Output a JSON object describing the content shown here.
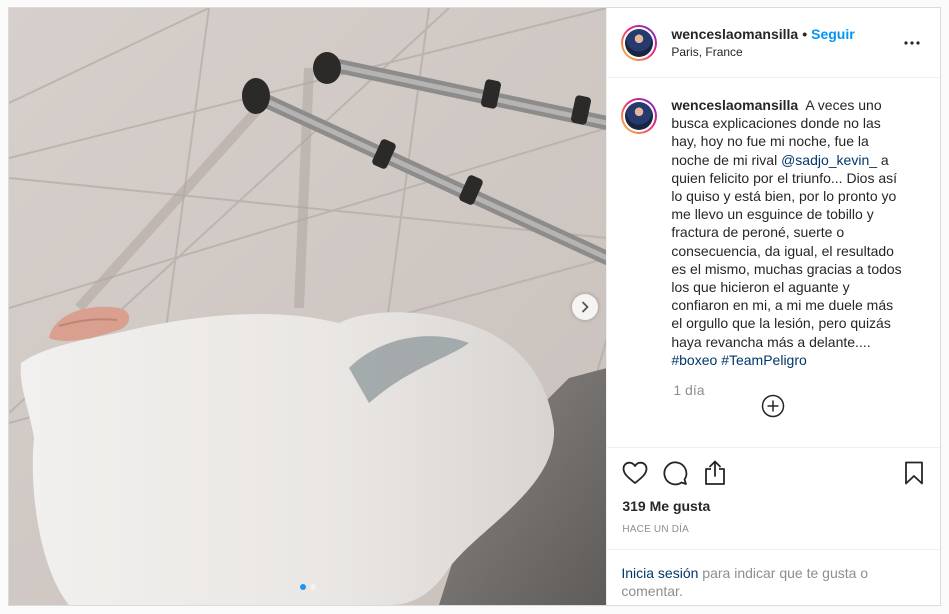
{
  "post": {
    "username": "wenceslaomansilla",
    "separator": "•",
    "follow_label": "Seguir",
    "location": "Paris, France",
    "caption": {
      "username": "wenceslaomansilla",
      "text_1": "A veces uno busca explicaciones donde no las hay, hoy no fue mi noche, fue la noche de mi rival",
      "mention": "@sadjo_kevin_",
      "text_2": "a quien felicito por el triunfo... Dios así lo quiso y está bien, por lo pronto yo me llevo un esguince de tobillo y fractura de peroné, suerte o consecuencia, da igual, el resultado es el mismo, muchas gracias a todos los que hicieron el aguante y confiaron en mi, a mi me duele más el orgullo que la lesión, pero quizás haya revancha más a delante....",
      "hashtag_1": "#boxeo",
      "hashtag_2": "#TeamPeligro",
      "time_ago": "1 día"
    },
    "likes_text": "319 Me gusta",
    "timestamp": "Hace un día",
    "login_prompt": {
      "link": "Inicia sesión",
      "text": "para indicar que te gusta o comentar."
    },
    "carousel": {
      "total": 2,
      "current": 1
    }
  },
  "icons": {
    "more": "more-options-icon",
    "next": "chevron-right-icon",
    "like": "heart-icon",
    "comment": "comment-icon",
    "share": "share-icon",
    "save": "bookmark-icon",
    "load_more": "plus-circle-icon"
  },
  "colors": {
    "accent": "#0095f6",
    "link": "#00376b",
    "muted": "#8e8e8e",
    "carousel_active": "#1e95f1"
  }
}
